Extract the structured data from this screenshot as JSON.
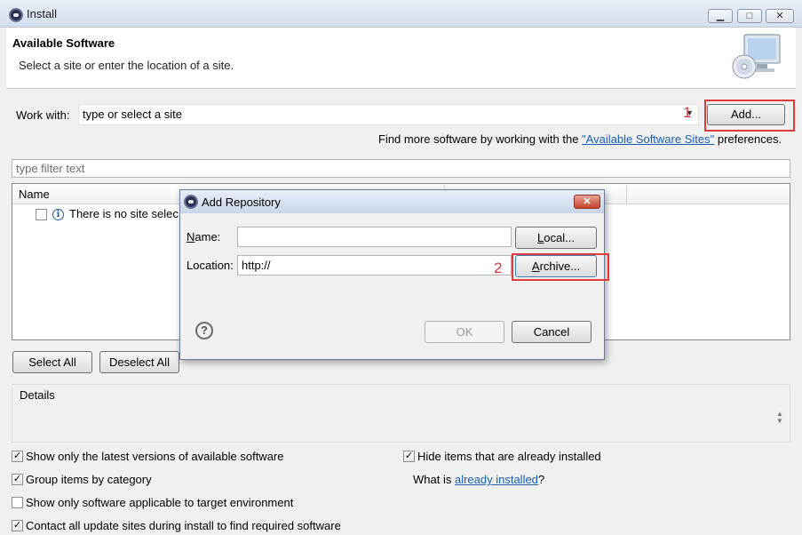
{
  "window": {
    "title": "Install",
    "minimize": "▁",
    "maximize": "□",
    "close": "✕"
  },
  "header": {
    "title": "Available Software",
    "subtitle": "Select a site or enter the location of a site."
  },
  "work_with": {
    "label": "Work with:",
    "value": "type or select a site",
    "add_button": "Add...",
    "annotation": "1",
    "find_more_prefix": "Find more software by working with the ",
    "find_more_link": "\"Available Software Sites\"",
    "find_more_suffix": " preferences."
  },
  "filter": {
    "placeholder": "type filter text"
  },
  "table": {
    "columns": [
      "Name"
    ],
    "rows": [
      {
        "checked": false,
        "text": "There is no site selec"
      }
    ]
  },
  "buttons": {
    "select_all": "Select All",
    "deselect_all": "Deselect All"
  },
  "details": {
    "label": "Details"
  },
  "options": [
    {
      "label": "Show only the latest versions of available software",
      "checked": true
    },
    {
      "label": "Group items by category",
      "checked": true
    },
    {
      "label": "Show only software applicable to target environment",
      "checked": false
    },
    {
      "label": "Contact all update sites during install to find required software",
      "checked": true
    },
    {
      "label": "Hide items that are already installed",
      "checked": true
    }
  ],
  "what_is": {
    "prefix": "What is ",
    "link": "already installed",
    "suffix": "?"
  },
  "dialog": {
    "title": "Add Repository",
    "name_label_u": "N",
    "name_label_rest": "ame:",
    "name_value": "",
    "location_label": "Location:",
    "location_value": "http://",
    "local_u": "L",
    "local_rest": "ocal...",
    "archive_u": "A",
    "archive_rest": "rchive...",
    "annotation": "2",
    "ok": "OK",
    "cancel": "Cancel",
    "help": "?"
  },
  "colors": {
    "annotation": "#e03a3a",
    "link": "#1a5fb4",
    "accent": "#c5422b"
  }
}
